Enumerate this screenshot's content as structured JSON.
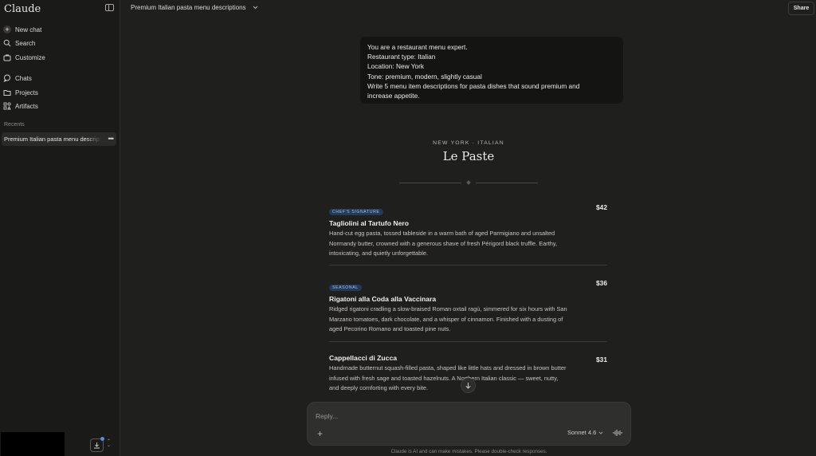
{
  "sidebar": {
    "logo": "Claude",
    "new_chat": "New chat",
    "search": "Search",
    "customize": "Customize",
    "chats": "Chats",
    "projects": "Projects",
    "artifacts": "Artifacts",
    "recents_label": "Recents",
    "recent_items": [
      {
        "label": "Premium Italian pasta menu descriptions"
      }
    ]
  },
  "header": {
    "title": "Premium Italian pasta menu descriptions",
    "share_label": "Share"
  },
  "user_message": {
    "lines": [
      "You are a restaurant menu expert.",
      "Restaurant type: Italian",
      "Location: New York",
      "Tone: premium, modern, slightly casual",
      "Write 5 menu item descriptions for pasta dishes that sound premium and",
      "increase appetite."
    ]
  },
  "menu": {
    "kicker": "NEW YORK · ITALIAN",
    "heading": "Le Paste",
    "dishes": [
      {
        "badge": "CHEF'S SIGNATURE",
        "name": "Tagliolini al Tartufo Nero",
        "price": "$42",
        "desc_lines": [
          "Hand-cut egg pasta, tossed tableside in a warm bath of aged Parmigiano and unsalted",
          "Normandy butter, crowned with a generous shave of fresh Périgord black truffle. Earthy,",
          "intoxicating, and quietly unforgettable."
        ]
      },
      {
        "badge": "SEASONAL",
        "name": "Rigatoni alla Coda alla Vaccinara",
        "price": "$36",
        "desc_lines": [
          "Ridged rigatoni cradling a slow-braised Roman oxtail ragù, simmered for six hours with San",
          "Marzano tomatoes, dark chocolate, and a whisper of cinnamon. Finished with a dusting of",
          "aged Pecorino Romano and toasted pine nuts."
        ]
      },
      {
        "badge": "",
        "name": "Cappellacci di Zucca",
        "price": "$31",
        "desc_lines": [
          "Handmade butternut squash-filled pasta, shaped like little hats and dressed in brown butter",
          "infused with fresh sage and toasted hazelnuts. A Northern Italian classic — sweet, nutty,",
          "and deeply comforting with every bite."
        ]
      }
    ]
  },
  "composer": {
    "placeholder": "Reply...",
    "model": "Sonnet 4.6",
    "disclaimer": "Claude is AI and can make mistakes. Please double-check responses."
  },
  "colors": {
    "background": "#1f1f1e",
    "sidebar": "#1a1a19",
    "badge_bg": "#243a5a",
    "badge_text": "#a9c1e6",
    "notification_dot": "#5a8bd6"
  }
}
